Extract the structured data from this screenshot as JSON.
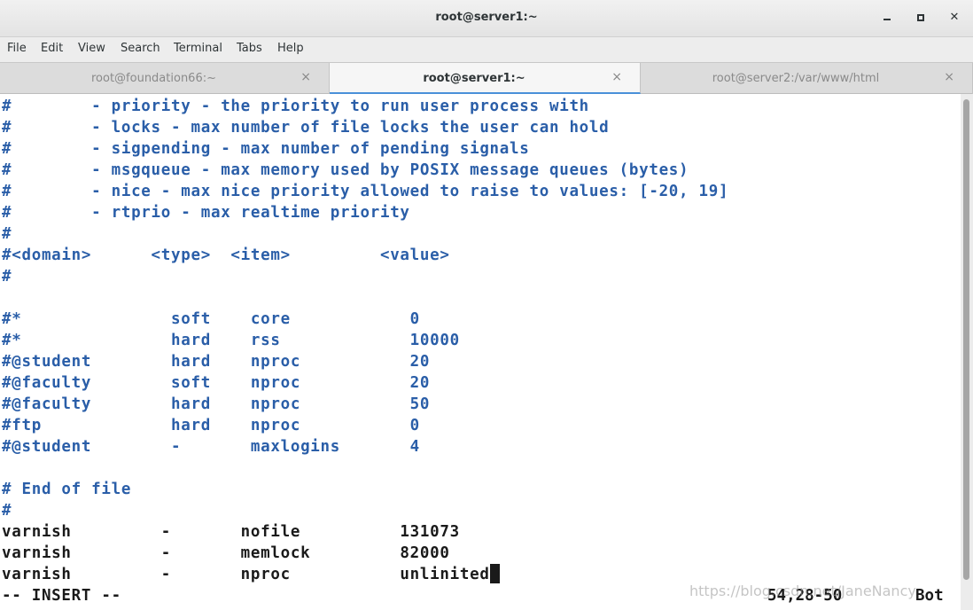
{
  "window": {
    "title": "root@server1:~",
    "controls": {
      "minimize": "minimize-icon",
      "maximize": "maximize-icon",
      "close": "close-icon"
    }
  },
  "menubar": {
    "items": [
      "File",
      "Edit",
      "View",
      "Search",
      "Terminal",
      "Tabs",
      "Help"
    ]
  },
  "tabs": [
    {
      "label": "root@foundation66:~",
      "active": false,
      "close": "×"
    },
    {
      "label": "root@server1:~",
      "active": true,
      "close": "×"
    },
    {
      "label": "root@server2:/var/www/html",
      "active": false,
      "close": "×"
    }
  ],
  "terminal": {
    "lines": [
      {
        "text": "#        - priority - the priority to run user process with",
        "style": "comment"
      },
      {
        "text": "#        - locks - max number of file locks the user can hold",
        "style": "comment"
      },
      {
        "text": "#        - sigpending - max number of pending signals",
        "style": "comment"
      },
      {
        "text": "#        - msgqueue - max memory used by POSIX message queues (bytes)",
        "style": "comment"
      },
      {
        "text": "#        - nice - max nice priority allowed to raise to values: [-20, 19]",
        "style": "comment"
      },
      {
        "text": "#        - rtprio - max realtime priority",
        "style": "comment"
      },
      {
        "text": "#",
        "style": "comment"
      },
      {
        "text": "#<domain>      <type>  <item>         <value>",
        "style": "comment"
      },
      {
        "text": "#",
        "style": "comment"
      },
      {
        "text": "",
        "style": "comment"
      },
      {
        "text": "#*               soft    core            0",
        "style": "comment"
      },
      {
        "text": "#*               hard    rss             10000",
        "style": "comment"
      },
      {
        "text": "#@student        hard    nproc           20",
        "style": "comment"
      },
      {
        "text": "#@faculty        soft    nproc           20",
        "style": "comment"
      },
      {
        "text": "#@faculty        hard    nproc           50",
        "style": "comment"
      },
      {
        "text": "#ftp             hard    nproc           0",
        "style": "comment"
      },
      {
        "text": "#@student        -       maxlogins       4",
        "style": "comment"
      },
      {
        "text": "",
        "style": "comment"
      },
      {
        "text": "# End of file",
        "style": "comment"
      },
      {
        "text": "#",
        "style": "comment"
      },
      {
        "text": "varnish         -       nofile          131073",
        "style": "plain"
      },
      {
        "text": "varnish         -       memlock         82000",
        "style": "plain"
      },
      {
        "text": "varnish         -       nproc           unlinited",
        "style": "plain"
      }
    ],
    "status": {
      "mode": "-- INSERT --",
      "position": "54,28-50",
      "scroll": "Bot"
    }
  },
  "watermark": "https://blog.csdn.net/JaneNancy"
}
